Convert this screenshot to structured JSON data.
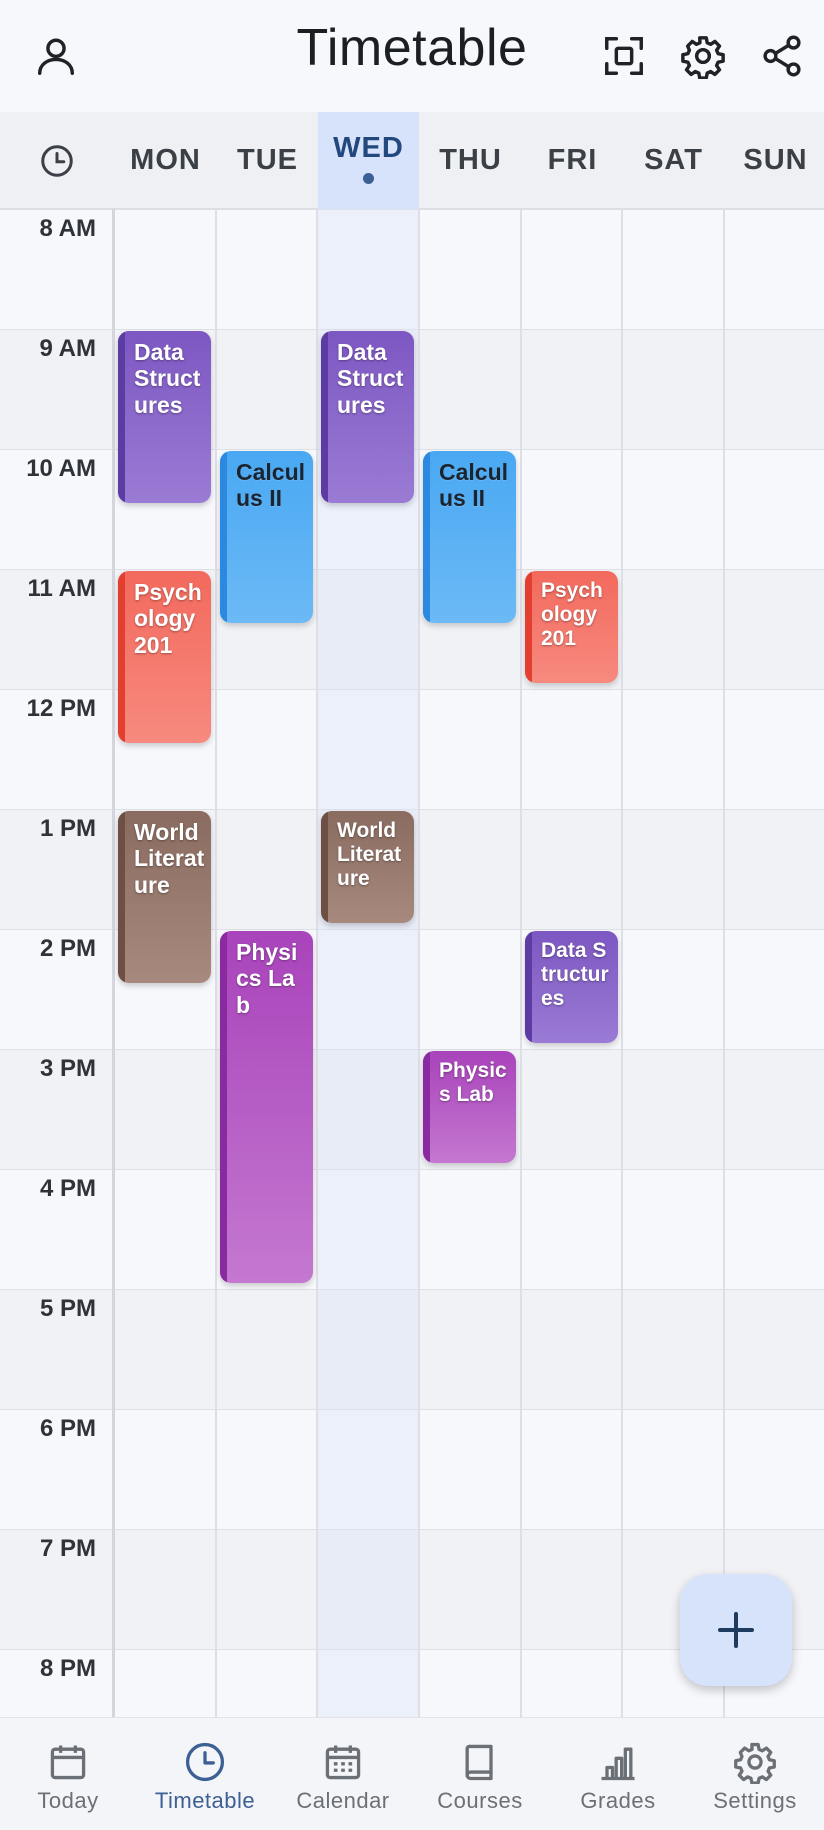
{
  "header": {
    "title": "Timetable",
    "icons": [
      "person-icon",
      "focus-frame-icon",
      "gear-icon",
      "share-icon"
    ]
  },
  "days": [
    {
      "label": "MON",
      "today": false
    },
    {
      "label": "TUE",
      "today": false
    },
    {
      "label": "WED",
      "today": true
    },
    {
      "label": "THU",
      "today": false
    },
    {
      "label": "FRI",
      "today": false
    },
    {
      "label": "SAT",
      "today": false
    },
    {
      "label": "SUN",
      "today": false
    }
  ],
  "hours": [
    "8 AM",
    "9 AM",
    "10 AM",
    "11 AM",
    "12 PM",
    "1 PM",
    "2 PM",
    "3 PM",
    "4 PM",
    "5 PM",
    "6 PM",
    "7 PM",
    "8 PM"
  ],
  "events": [
    {
      "title": "Data Structures",
      "day": 0,
      "start": 9,
      "end": 10.45,
      "color": "purple"
    },
    {
      "title": "Psychology 201",
      "day": 0,
      "start": 11,
      "end": 12.45,
      "color": "red"
    },
    {
      "title": "World Literature",
      "day": 0,
      "start": 13,
      "end": 14.45,
      "color": "brown"
    },
    {
      "title": "Calculus II",
      "day": 1,
      "start": 10,
      "end": 11.45,
      "color": "blue"
    },
    {
      "title": "Physics Lab",
      "day": 1,
      "start": 14,
      "end": 16.95,
      "color": "magenta"
    },
    {
      "title": "Data Structures",
      "day": 2,
      "start": 9,
      "end": 10.45,
      "color": "purple"
    },
    {
      "title": "World Literature",
      "day": 2,
      "start": 13,
      "end": 13.95,
      "color": "brown",
      "small": true
    },
    {
      "title": "Calculus II",
      "day": 3,
      "start": 10,
      "end": 11.45,
      "color": "blue"
    },
    {
      "title": "Physics Lab",
      "day": 3,
      "start": 15,
      "end": 15.95,
      "color": "magenta",
      "small": true
    },
    {
      "title": "Psychology 201",
      "day": 4,
      "start": 11,
      "end": 11.95,
      "color": "red",
      "small": true
    },
    {
      "title": "Data Structures",
      "day": 4,
      "start": 14,
      "end": 14.95,
      "color": "purple",
      "small": true
    }
  ],
  "colors": {
    "purple": "#7d57c2",
    "blue": "#49a8f2",
    "red": "#f3695d",
    "brown": "#8a6b5f",
    "magenta": "#a943bb",
    "accent": "#3c5f94"
  },
  "nav": [
    {
      "label": "Today",
      "icon": "calendar-day-icon",
      "active": false
    },
    {
      "label": "Timetable",
      "icon": "clock-icon",
      "active": true
    },
    {
      "label": "Calendar",
      "icon": "calendar-grid-icon",
      "active": false
    },
    {
      "label": "Courses",
      "icon": "book-icon",
      "active": false
    },
    {
      "label": "Grades",
      "icon": "bar-chart-icon",
      "active": false
    },
    {
      "label": "Settings",
      "icon": "gear-icon",
      "active": false
    }
  ],
  "fab": {
    "icon": "plus-icon"
  }
}
